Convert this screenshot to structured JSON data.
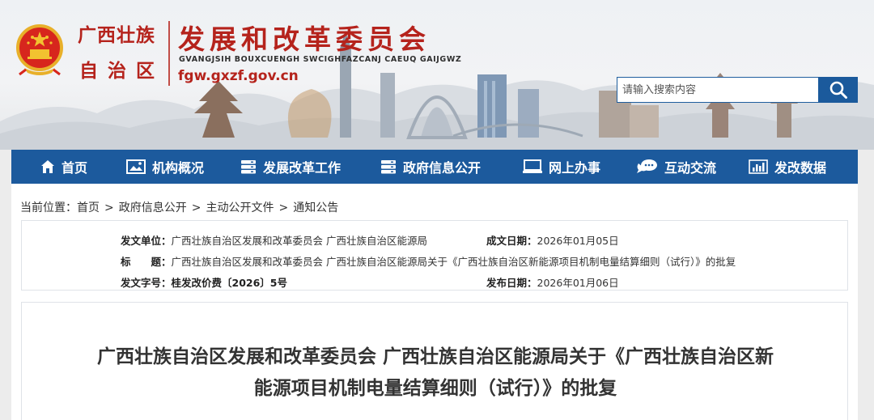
{
  "header": {
    "province_line1": "广西壮族",
    "province_line2": "自治区",
    "org_name": "发展和改革委员会",
    "org_name_en": "GVANGJSIH BOUXCUENGH SWCIGHFAZCANJ CAEUQ GAIJGWZ",
    "domain": "fgw.gxzf.gov.cn",
    "emblem_icon": "national-emblem-icon"
  },
  "search": {
    "placeholder": "请输入搜索内容",
    "button_icon": "search-icon"
  },
  "nav": {
    "items": [
      {
        "label": "首页",
        "icon": "home-icon"
      },
      {
        "label": "机构概况",
        "icon": "image-icon"
      },
      {
        "label": "发展改革工作",
        "icon": "server-icon"
      },
      {
        "label": "政府信息公开",
        "icon": "server-icon"
      },
      {
        "label": "网上办事",
        "icon": "monitor-icon"
      },
      {
        "label": "互动交流",
        "icon": "chat-icon"
      },
      {
        "label": "发改数据",
        "icon": "bar-chart-icon"
      }
    ]
  },
  "breadcrumb": {
    "prefix": "当前位置：",
    "items": [
      "首页",
      "政府信息公开",
      "主动公开文件",
      "通知公告"
    ],
    "separator": ">"
  },
  "meta": {
    "issuer_label": "发文单位：",
    "issuer_value": "广西壮族自治区发展和改革委员会 广西壮族自治区能源局",
    "date_written_label": "成文日期：",
    "date_written_value": "2026年01月05日",
    "title_label": "标　　题：",
    "title_value": "广西壮族自治区发展和改革委员会 广西壮族自治区能源局关于《广西壮族自治区新能源项目机制电量结算细则（试行）》的批复",
    "doc_number_label": "发文字号：",
    "doc_number_value": "桂发改价费〔2026〕5号",
    "publish_date_label": "发布日期：",
    "publish_date_value": "2026年01月06日"
  },
  "article": {
    "title_line1": "广西壮族自治区发展和改革委员会 广西壮族自治区能源局关于《广西壮族自治区新",
    "title_line2": "能源项目机制电量结算细则（试行）》的批复"
  },
  "colors": {
    "brand_red": "#b5231c",
    "nav_blue": "#1c5a9d"
  }
}
